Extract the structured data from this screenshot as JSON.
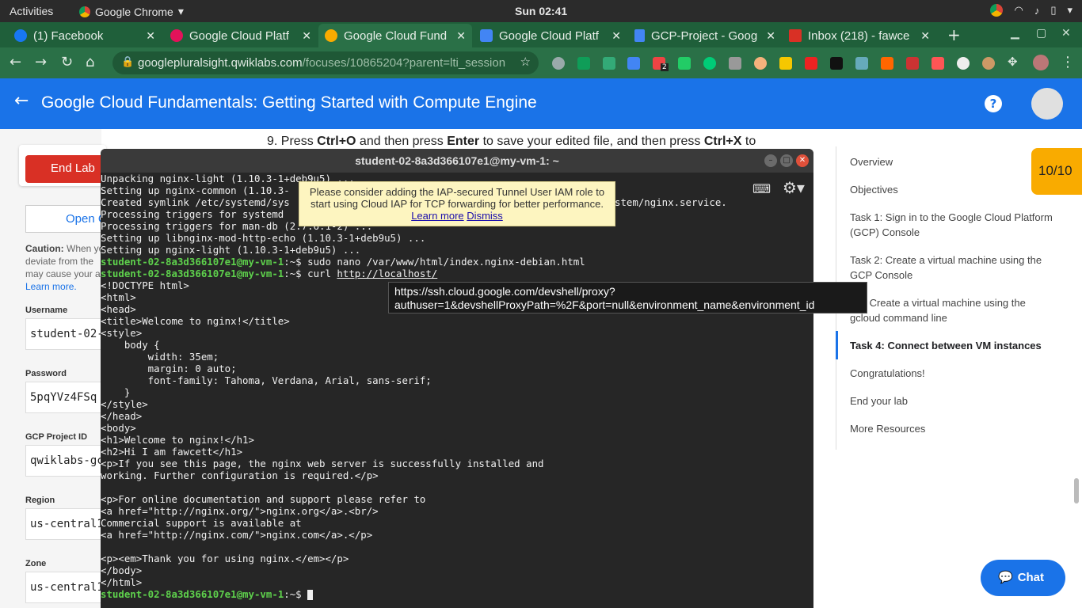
{
  "topbar": {
    "activities": "Activities",
    "app_name": "Google Chrome",
    "clock": "Sun 02:41"
  },
  "tabs": [
    {
      "title": "(1) Facebook",
      "favicon_color": "#1877f2"
    },
    {
      "title": "Google Cloud Platf",
      "favicon_color": "#e3125a"
    },
    {
      "title": "Google Cloud Fund",
      "favicon_color": "#f9ab00"
    },
    {
      "title": "Google Cloud Platf",
      "favicon_color": "#4285f4"
    },
    {
      "title": "GCP-Project - Goog",
      "favicon_color": "#4285f4"
    },
    {
      "title": "Inbox (218) - fawce",
      "favicon_color": "#d93025"
    }
  ],
  "browser": {
    "url_host": "googlepluralsight.qwiklabs.com",
    "url_path": "/focuses/10865204?parent=lti_session",
    "extension_badge": "2"
  },
  "appbar": {
    "title": "Google Cloud Fundamentals: Getting Started with Compute Engine",
    "help_glyph": "?"
  },
  "lab_panel": {
    "end_lab": "End Lab",
    "open_label": "Open C",
    "caution_bold": "Caution:",
    "caution_lines": [
      "When yo",
      "deviate from the",
      "may cause your a"
    ],
    "learn_more": "Learn more.",
    "fields": [
      {
        "label": "Username",
        "value": "student-02-"
      },
      {
        "label": "Password",
        "value": "5pqYVz4FSq"
      },
      {
        "label": "GCP Project ID",
        "value": "qwiklabs-gc"
      },
      {
        "label": "Region",
        "value": "us-central1"
      },
      {
        "label": "Zone",
        "value": "us-central1"
      }
    ]
  },
  "instruction": {
    "num": "9. Press ",
    "k1": "Ctrl+O",
    "t1": " and then press ",
    "k2": "Enter",
    "t2": " to save your edited file, and then press ",
    "k3": "Ctrl+X",
    "t3": " to"
  },
  "score": "10/10",
  "outline": [
    "Overview",
    "Objectives",
    "Task 1: Sign in to the Google Cloud Platform (GCP) Console",
    "Task 2: Create a virtual machine using the GCP Console",
    "k 3: Create a virtual machine using the gcloud command line",
    "Task 4: Connect between VM instances",
    "Congratulations!",
    "End your lab",
    "More Resources"
  ],
  "chat": {
    "label": "Chat"
  },
  "terminal": {
    "title": "student-02-8a3d366107e1@my-vm-1: ~",
    "prompt": "student-02-8a3d366107e1@my-vm-1",
    "prompt_suffix": ":~$ ",
    "lines": [
      {
        "t": "Unpacking nginx-light (1.10.3-1+deb9u5) ..."
      },
      {
        "t": "Setting up nginx-common (1.10.3-"
      },
      {
        "t": "Created symlink /etc/systemd/sys                                               stemd/system/nginx.service."
      },
      {
        "t": "Processing triggers for systemd"
      },
      {
        "t": "Processing triggers for man-db (2.7.6.1-2) ..."
      },
      {
        "t": "Setting up libnginx-mod-http-echo (1.10.3-1+deb9u5) ..."
      },
      {
        "t": "Setting up nginx-light (1.10.3-1+deb9u5) ..."
      },
      {
        "p": "student-02-8a3d366107e1@my-vm-1",
        "s": ":~$ ",
        "t": "sudo nano /var/www/html/index.nginx-debian.html"
      },
      {
        "p": "student-02-8a3d366107e1@my-vm-1",
        "s": ":~$ ",
        "t": "curl ",
        "u": "http://localhost/"
      },
      {
        "t": "<!DOCTYPE html>"
      },
      {
        "t": "<html>"
      },
      {
        "t": "<head>"
      },
      {
        "t": "<title>Welcome to nginx!</title>"
      },
      {
        "t": "<style>"
      },
      {
        "t": "    body {"
      },
      {
        "t": "        width: 35em;"
      },
      {
        "t": "        margin: 0 auto;"
      },
      {
        "t": "        font-family: Tahoma, Verdana, Arial, sans-serif;"
      },
      {
        "t": "    }"
      },
      {
        "t": "</style>"
      },
      {
        "t": "</head>"
      },
      {
        "t": "<body>"
      },
      {
        "t": "<h1>Welcome to nginx!</h1>"
      },
      {
        "t": "<h2>Hi I am fawcett</h1>"
      },
      {
        "t": "<p>If you see this page, the nginx web server is successfully installed and"
      },
      {
        "t": "working. Further configuration is required.</p>"
      },
      {
        "t": ""
      },
      {
        "t": "<p>For online documentation and support please refer to"
      },
      {
        "t": "<a href=\"http://nginx.org/\">nginx.org</a>.<br/>"
      },
      {
        "t": "Commercial support is available at"
      },
      {
        "t": "<a href=\"http://nginx.com/\">nginx.com</a>.</p>"
      },
      {
        "t": ""
      },
      {
        "t": "<p><em>Thank you for using nginx.</em></p>"
      },
      {
        "t": "</body>"
      },
      {
        "t": "</html>"
      },
      {
        "p": "student-02-8a3d366107e1@my-vm-1",
        "s": ":~$ ",
        "t": "",
        "cursor": true
      }
    ]
  },
  "iap_notice": {
    "text": "Please consider adding the IAP-secured Tunnel User IAM role to start using Cloud IAP for TCP forwarding for better performance.",
    "learn_more": "Learn more",
    "dismiss": "Dismiss"
  },
  "tooltip": {
    "line1": "https://ssh.cloud.google.com/devshell/proxy?",
    "line2": "authuser=1&devshellProxyPath=%2F&port=null&environment_name&environment_id"
  }
}
